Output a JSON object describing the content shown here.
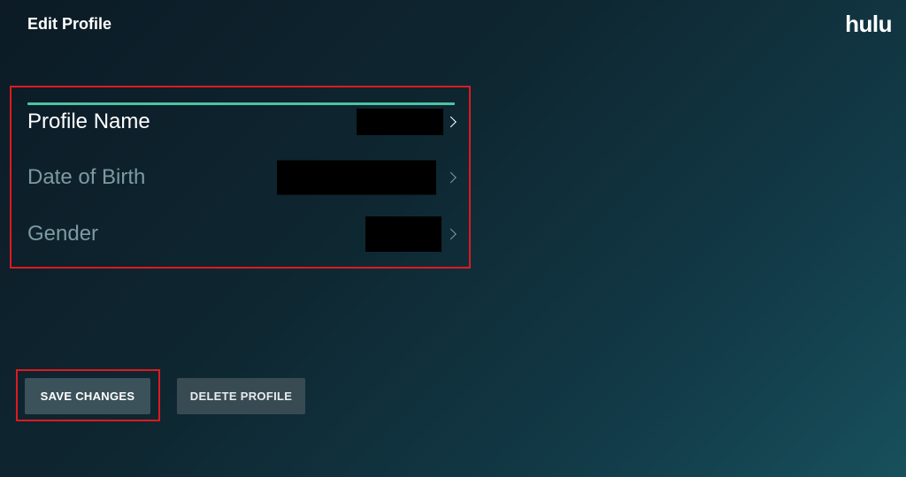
{
  "header": {
    "title": "Edit Profile",
    "logo_text": "hulu"
  },
  "fields": [
    {
      "label": "Profile Name",
      "value_hidden": true
    },
    {
      "label": "Date of Birth",
      "value_hidden": true
    },
    {
      "label": "Gender",
      "value_hidden": true
    }
  ],
  "actions": {
    "save_label": "SAVE CHANGES",
    "delete_label": "DELETE PROFILE"
  },
  "colors": {
    "focus_accent": "#4cc3a4",
    "highlight_outline": "#e0191f",
    "inactive_text": "#7d9aa1",
    "button_bg": "#3b525a"
  }
}
